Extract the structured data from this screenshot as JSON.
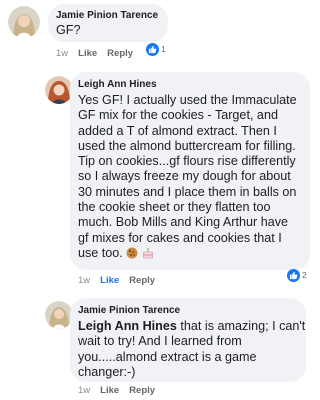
{
  "comments": [
    {
      "author": "Jamie Pinion Tarence",
      "text": "GF?",
      "time": "1w",
      "like_label": "Like",
      "reply_label": "Reply",
      "reaction_count": "1"
    },
    {
      "author": "Leigh Ann Hines",
      "text": "Yes GF! I actually used the Immaculate\nGF mix for the cookies - Target, and\nadded a T of almond extract. Then I\nused the almond buttercream for filling.\nTip on cookies...gf flours rise differently\nso I always freeze my dough for about\n30 minutes and I place them in balls on\nthe cookie sheet or they flatten too\nmuch.  Bob Mills and King Arthur have\ngf mixes for cakes and cookies that I\nuse too.",
      "emojis": [
        "cookie-emoji",
        "cake-emoji"
      ],
      "time": "1w",
      "like_label": "Like",
      "reply_label": "Reply",
      "reaction_count": "2",
      "liked": true
    },
    {
      "author": "Jamie Pinion Tarence",
      "mention": "Leigh Ann Hines",
      "text": " that is amazing; I can't\nwait to try! And I learned from\nyou.....almond extract is a game\nchanger:-)",
      "time": "1w",
      "like_label": "Like",
      "reply_label": "Reply"
    }
  ],
  "colors": {
    "bubble": "#f0f2f5",
    "accent": "#1877f2",
    "meta": "#8a8d91"
  },
  "icons": {
    "reaction": "thumbs-up-icon"
  }
}
